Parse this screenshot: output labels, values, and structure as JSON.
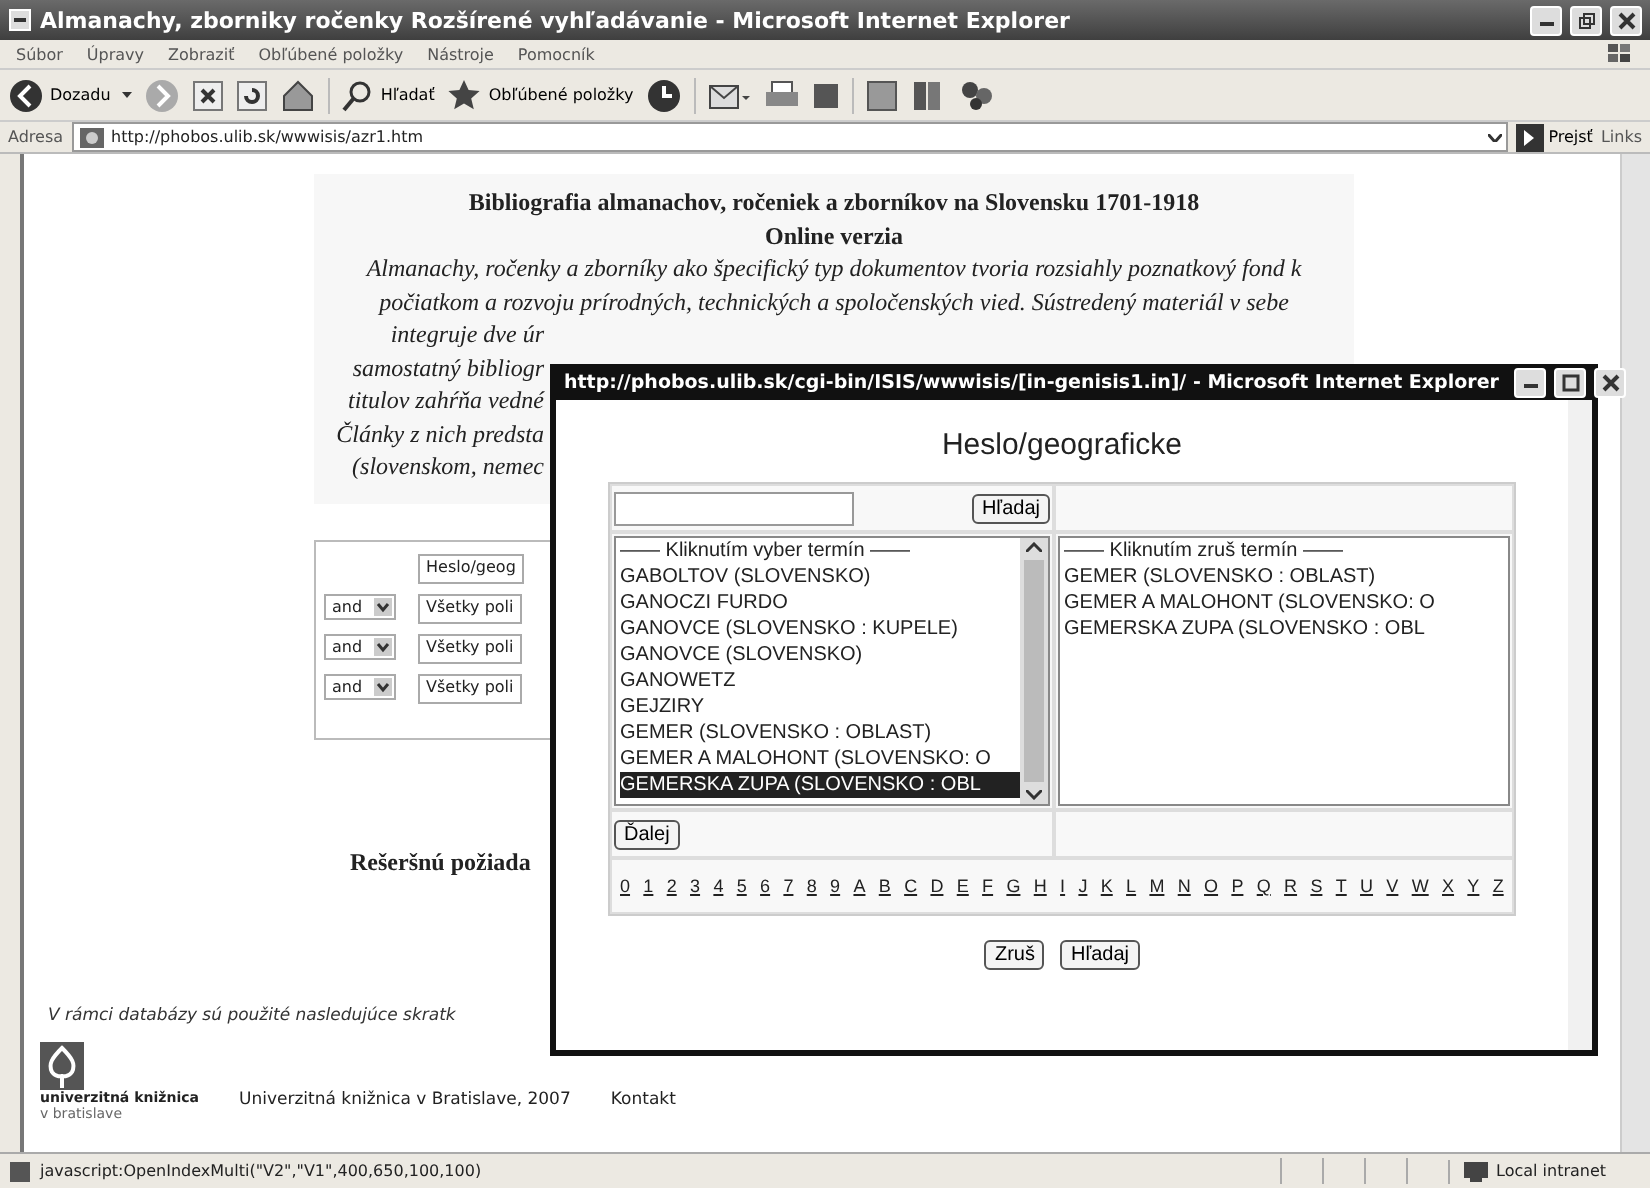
{
  "window": {
    "title": "Almanachy, zborniky ročenky Rozšírené vyhľadávanie - Microsoft Internet Explorer"
  },
  "menu": [
    "Súbor",
    "Úpravy",
    "Zobraziť",
    "Obľúbené položky",
    "Nástroje",
    "Pomocník"
  ],
  "toolbar": {
    "back": "Dozadu",
    "search": "Hľadať",
    "favorites": "Obľúbené položky"
  },
  "address": {
    "label": "Adresa",
    "url": "http://phobos.ulib.sk/wwwisis/azr1.htm",
    "go": "Prejsť",
    "links": "Links"
  },
  "page": {
    "heading": [
      "Bibliografia almanachov, ročeniek a zborníkov na Slovensku 1701-1918",
      "Online verzia"
    ],
    "intro_lines": [
      "Almanachy, ročenky a zborníky ako špecifický typ dokumentov tvoria rozsiahly poznatkový fond k",
      "počiatkom a rozvoju prírodných, technických a spoločenských vied. Sústredený materiál v sebe"
    ],
    "intro_fragments": [
      "integruje dve úr",
      "samostatný bibliogr",
      "titulov zahŕňa vedné",
      "Články z nich predsta",
      "(slovenskom, nemec"
    ],
    "form_rows": [
      {
        "field": "Heslo/geog"
      },
      {
        "operator": "and",
        "field": "Všetky poli"
      },
      {
        "operator": "and",
        "field": "Všetky poli"
      },
      {
        "operator": "and",
        "field": "Všetky poli"
      }
    ],
    "request_heading": "Rešeršnú požiada",
    "abbrev_note": "V rámci databázy sú použité nasledujúce skratk",
    "footer": {
      "logo_line1": "univerzitná knižnica",
      "logo_line2": "v bratislave",
      "copyright": "Univerzitná knižnica v Bratislave, 2007",
      "contact": "Kontakt"
    }
  },
  "popup": {
    "title": "http://phobos.ulib.sk/cgi-bin/ISIS/wwwisis/[in-genisis1.in]/ - Microsoft Internet Explorer",
    "heading": "Heslo/geograficke",
    "search_button": "Hľadaj",
    "left_list": {
      "header": "—— Kliknutím vyber termín ——",
      "items": [
        {
          "text": "GABOLTOV (SLOVENSKO)",
          "selected": false
        },
        {
          "text": "GANOCZI FURDO",
          "selected": false
        },
        {
          "text": "GANOVCE (SLOVENSKO : KUPELE)",
          "selected": false
        },
        {
          "text": "GANOVCE (SLOVENSKO)",
          "selected": false
        },
        {
          "text": "GANOWETZ",
          "selected": false
        },
        {
          "text": "GEJZIRY",
          "selected": false
        },
        {
          "text": "GEMER (SLOVENSKO : OBLAST)",
          "selected": false
        },
        {
          "text": "GEMER A MALOHONT (SLOVENSKO: O",
          "selected": false
        },
        {
          "text": "GEMERSKA ZUPA (SLOVENSKO : OBL",
          "selected": true
        }
      ]
    },
    "right_list": {
      "header": "—— Kliknutím zruš termín ——",
      "items": [
        "GEMER (SLOVENSKO : OBLAST)",
        "GEMER A MALOHONT (SLOVENSKO: O",
        "GEMERSKA ZUPA (SLOVENSKO : OBL"
      ]
    },
    "next_button": "Ďalej",
    "letters": [
      "0",
      "1",
      "2",
      "3",
      "4",
      "5",
      "6",
      "7",
      "8",
      "9",
      "A",
      "B",
      "C",
      "D",
      "E",
      "F",
      "G",
      "H",
      "I",
      "J",
      "K",
      "L",
      "M",
      "N",
      "O",
      "P",
      "Q",
      "R",
      "S",
      "T",
      "U",
      "V",
      "W",
      "X",
      "Y",
      "Z"
    ],
    "buttons": [
      "Zruš",
      "Hľadaj"
    ]
  },
  "status_bar": {
    "text": "javascript:OpenIndexMulti(\"V2\",\"V1\",400,650,100,100)",
    "zone": "Local intranet"
  }
}
